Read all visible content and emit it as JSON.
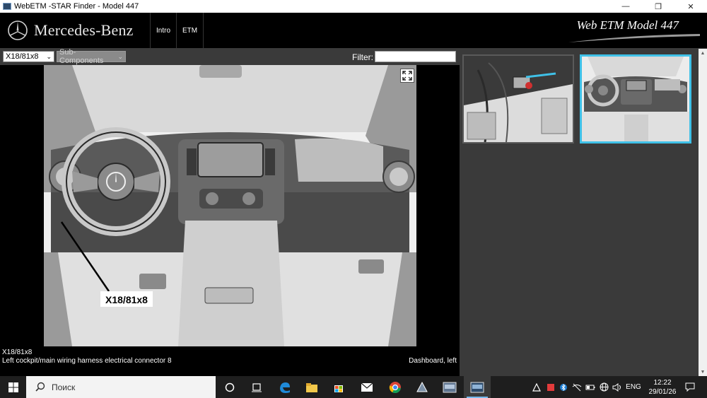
{
  "window": {
    "title": "WebETM -STAR Finder - Model 447",
    "minimize": "—",
    "maximize": "❐",
    "close": "✕"
  },
  "header": {
    "brand": "Mercedes-Benz",
    "nav": [
      "Intro",
      "ETM"
    ],
    "etm_title": "Web ETM Model 447"
  },
  "toolbar": {
    "component_select": "X18/81x8",
    "subcomponent_select": "Sub-Components",
    "filter_label": "Filter:",
    "filter_value": ""
  },
  "viewer": {
    "callout_label": "X18/81x8"
  },
  "caption": {
    "code": "X18/81x8",
    "description": "Left cockpit/main wiring harness electrical connector 8",
    "location": "Dashboard, left"
  },
  "thumbnails": {
    "selected_index": 1,
    "highlight_color": "#3fc1e8"
  },
  "taskbar": {
    "search_placeholder": "Поиск",
    "language": "ENG",
    "time": "12:22",
    "date": "29/01/26"
  },
  "colors": {
    "header_bg": "#000000",
    "panel_bg": "#3a3a3a",
    "accent": "#3fc1e8",
    "taskbar_bg": "#1e1e1e"
  }
}
